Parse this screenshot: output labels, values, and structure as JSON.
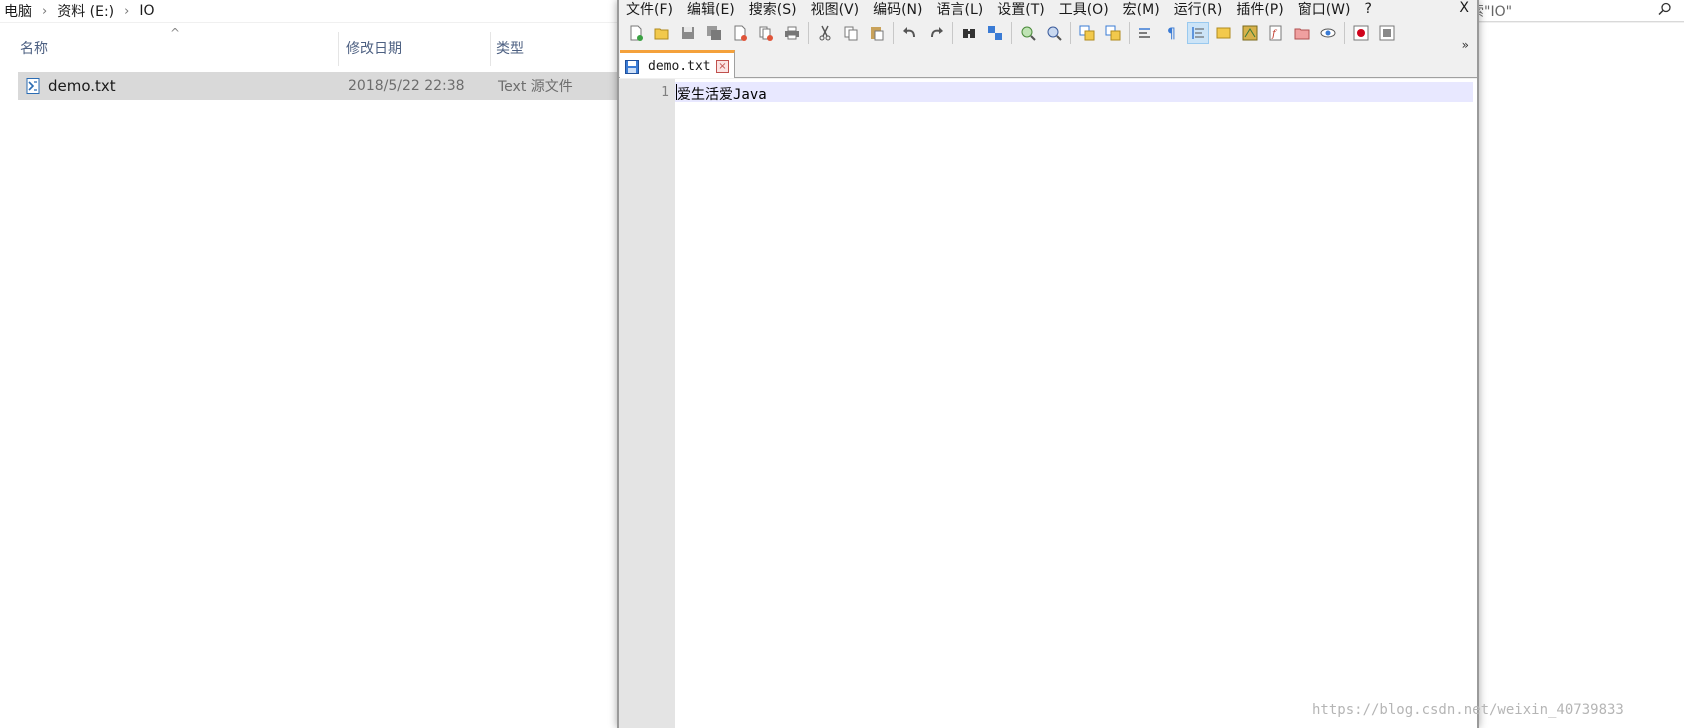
{
  "explorer": {
    "breadcrumb": [
      "电脑",
      "资料 (E:)",
      "IO"
    ],
    "search_placeholder": "索\"IO\"",
    "columns": {
      "name": "名称",
      "date": "修改日期",
      "type": "类型"
    },
    "files": [
      {
        "name": "demo.txt",
        "date": "2018/5/22 22:38",
        "type": "Text 源文件"
      }
    ]
  },
  "notepad": {
    "menu": [
      "文件(F)",
      "编辑(E)",
      "搜索(S)",
      "视图(V)",
      "编码(N)",
      "语言(L)",
      "设置(T)",
      "工具(O)",
      "宏(M)",
      "运行(R)",
      "插件(P)",
      "窗口(W)",
      "?"
    ],
    "close_label": "X",
    "toolbar_icons": [
      "new-file-icon",
      "open-file-icon",
      "save-icon",
      "save-all-icon",
      "close-icon",
      "close-all-icon",
      "print-icon",
      "cut-icon",
      "copy-icon",
      "paste-icon",
      "undo-icon",
      "redo-icon",
      "find-icon",
      "replace-icon",
      "zoom-in-icon",
      "zoom-out-icon",
      "sync-vertical-icon",
      "sync-horizontal-icon",
      "word-wrap-icon",
      "show-all-chars-icon",
      "indent-guide-icon",
      "user-lang-icon",
      "doc-map-icon",
      "function-list-icon",
      "folder-workspace-icon",
      "monitor-icon",
      "record-macro-icon",
      "stop-macro-icon"
    ],
    "overflow_label": "»",
    "tab": {
      "label": "demo.txt",
      "close": "×"
    },
    "lines": [
      {
        "number": "1",
        "text": "爱生活爱Java"
      }
    ]
  },
  "watermark": "https://blog.csdn.net/weixin_40739833",
  "colors": {
    "tab_accent": "#f4a13b",
    "selection": "#d9d9d9",
    "current_line": "#e8e8ff"
  }
}
